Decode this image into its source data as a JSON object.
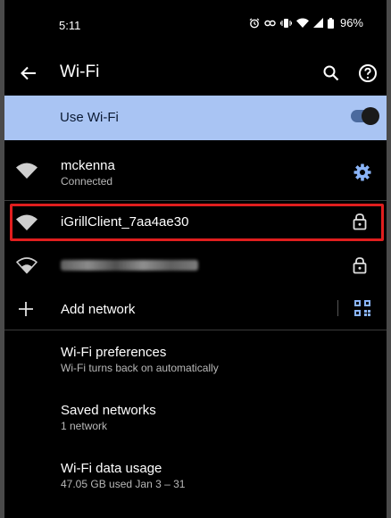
{
  "status_bar": {
    "time": "5:11",
    "battery": "96%",
    "icons": [
      "alarm-icon",
      "link-icon",
      "vibrate-icon",
      "wifi-signal-icon",
      "cell-signal-icon",
      "battery-icon"
    ]
  },
  "app_bar": {
    "title": "Wi-Fi"
  },
  "use_wifi": {
    "label": "Use Wi-Fi",
    "enabled": true
  },
  "networks": [
    {
      "name": "mckenna",
      "status": "Connected",
      "action": "settings"
    },
    {
      "name": "iGrillClient_7aa4ae30",
      "secured": true
    },
    {
      "name": "",
      "secured": true,
      "obscured": true
    }
  ],
  "add_network": {
    "label": "Add network"
  },
  "menu": [
    {
      "title": "Wi-Fi preferences",
      "subtitle": "Wi-Fi turns back on automatically"
    },
    {
      "title": "Saved networks",
      "subtitle": "1 network"
    },
    {
      "title": "Wi-Fi data usage",
      "subtitle": "47.05 GB used Jan 3 – 31"
    }
  ],
  "colors": {
    "accent_bar": "#a9c4f3",
    "highlight": "#e01e1e",
    "gear": "#8ab4f8"
  }
}
